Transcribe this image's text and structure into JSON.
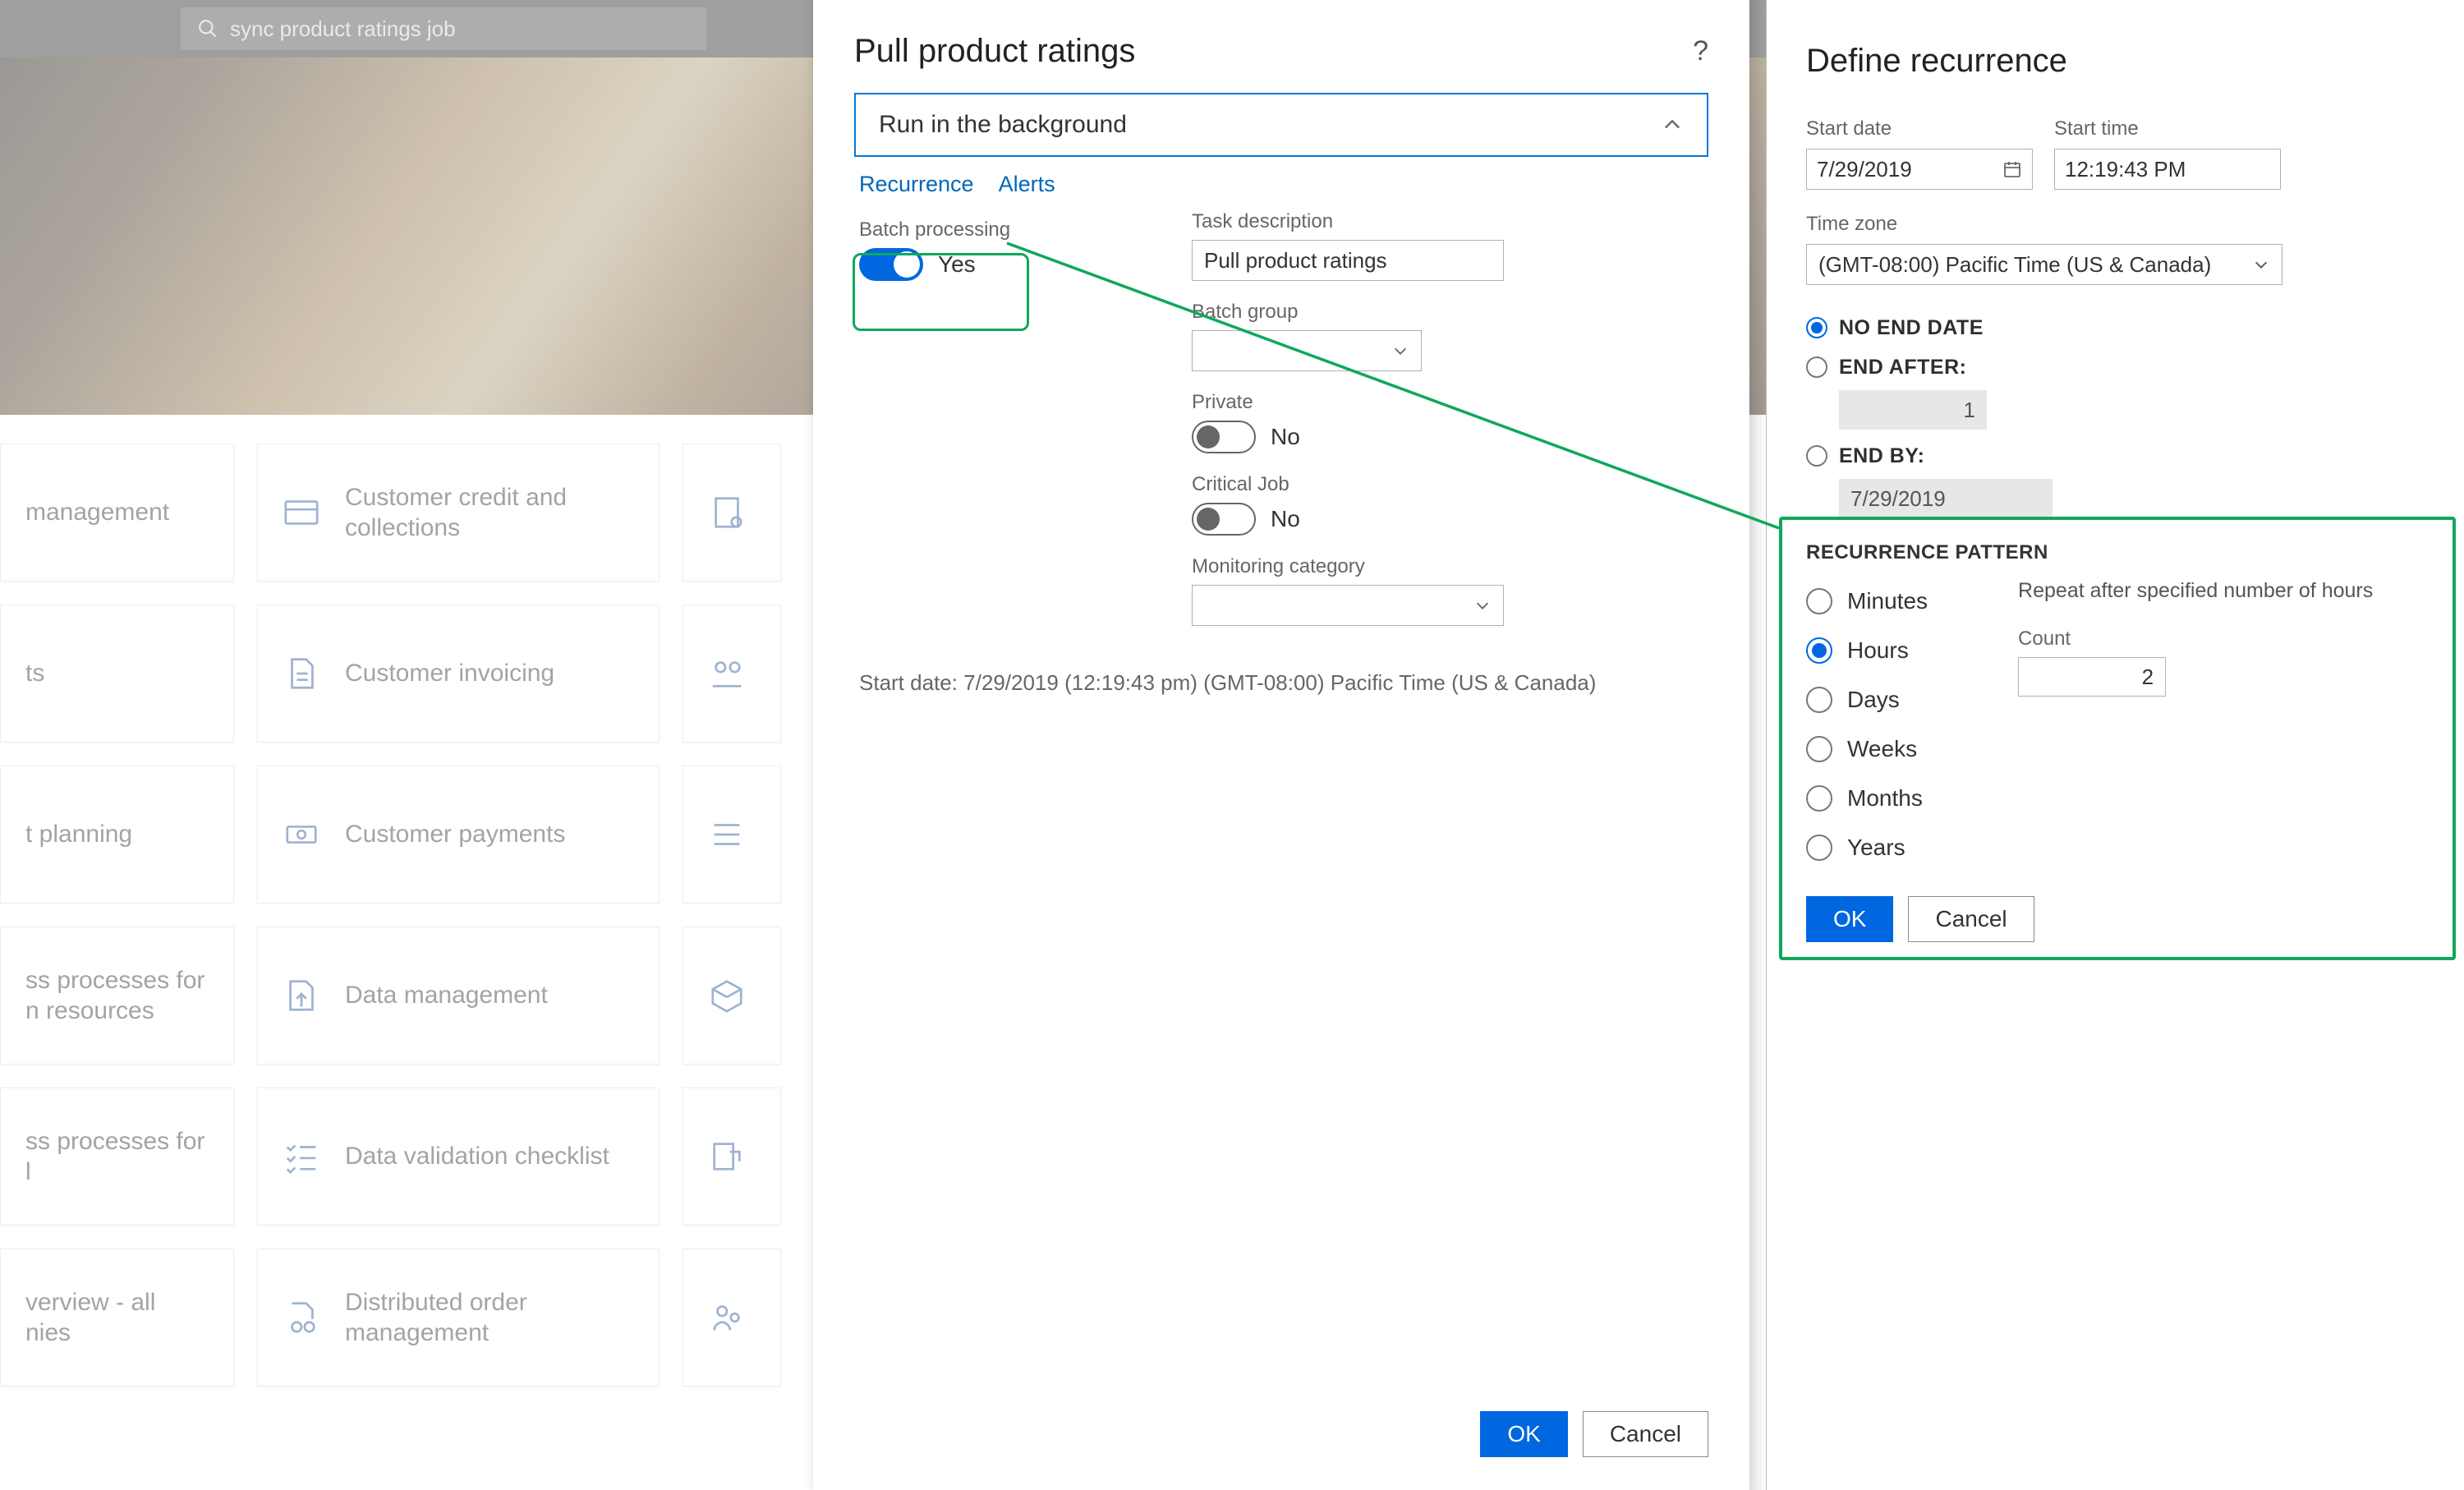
{
  "search": {
    "value": "sync product ratings job"
  },
  "tiles": {
    "col0": [
      {
        "label": "management"
      },
      {
        "label": "ts"
      },
      {
        "label": "t planning"
      },
      {
        "label": "ss processes for\nn resources"
      },
      {
        "label": "ss processes for\nl"
      },
      {
        "label": "verview - all\nnies"
      }
    ],
    "col1": [
      {
        "label": "Customer credit and collections"
      },
      {
        "label": "Customer invoicing"
      },
      {
        "label": "Customer payments"
      },
      {
        "label": "Data management"
      },
      {
        "label": "Data validation checklist"
      },
      {
        "label": "Distributed order management"
      }
    ]
  },
  "panel": {
    "title": "Pull product ratings",
    "accordion": "Run in the background",
    "tabs": {
      "recurrence": "Recurrence",
      "alerts": "Alerts"
    },
    "batch": {
      "label": "Batch processing",
      "state": "Yes"
    },
    "task": {
      "label": "Task description",
      "value": "Pull product ratings"
    },
    "group": {
      "label": "Batch group"
    },
    "private": {
      "label": "Private",
      "state": "No"
    },
    "critical": {
      "label": "Critical Job",
      "state": "No"
    },
    "monitor": {
      "label": "Monitoring category"
    },
    "startline": "Start date: 7/29/2019 (12:19:43 pm) (GMT-08:00) Pacific Time (US & Canada)",
    "ok": "OK",
    "cancel": "Cancel"
  },
  "rec": {
    "title": "Define recurrence",
    "startdate": {
      "label": "Start date",
      "value": "7/29/2019"
    },
    "starttime": {
      "label": "Start time",
      "value": "12:19:43 PM"
    },
    "tz": {
      "label": "Time zone",
      "value": "(GMT-08:00) Pacific Time (US & Canada)"
    },
    "noend": "NO END DATE",
    "endafter": {
      "label": "END AFTER:",
      "value": "1"
    },
    "endby": {
      "label": "END BY:",
      "value": "7/29/2019"
    },
    "patternhead": "RECURRENCE PATTERN",
    "options": {
      "minutes": "Minutes",
      "hours": "Hours",
      "days": "Days",
      "weeks": "Weeks",
      "months": "Months",
      "years": "Years"
    },
    "repeat": {
      "caption": "Repeat after specified number of hours",
      "countlabel": "Count",
      "count": "2"
    },
    "ok": "OK",
    "cancel": "Cancel"
  }
}
